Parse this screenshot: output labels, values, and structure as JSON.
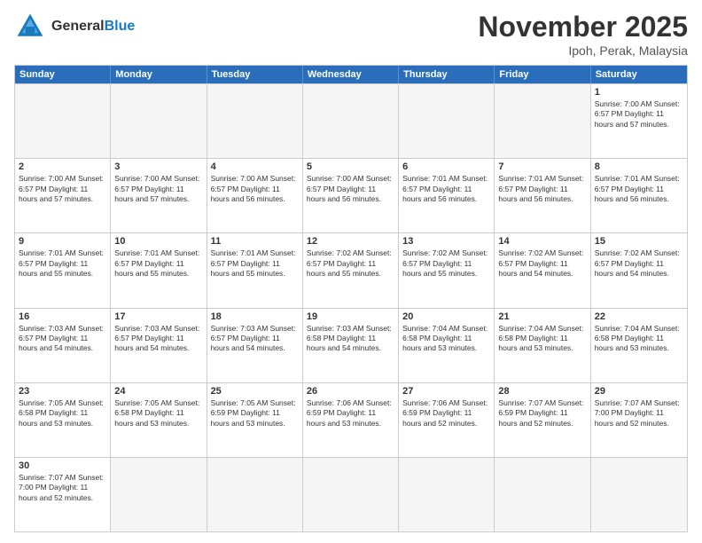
{
  "header": {
    "logo_general": "General",
    "logo_blue": "Blue",
    "month_title": "November 2025",
    "location": "Ipoh, Perak, Malaysia"
  },
  "weekdays": [
    "Sunday",
    "Monday",
    "Tuesday",
    "Wednesday",
    "Thursday",
    "Friday",
    "Saturday"
  ],
  "rows": [
    [
      {
        "day": "",
        "content": ""
      },
      {
        "day": "",
        "content": ""
      },
      {
        "day": "",
        "content": ""
      },
      {
        "day": "",
        "content": ""
      },
      {
        "day": "",
        "content": ""
      },
      {
        "day": "",
        "content": ""
      },
      {
        "day": "1",
        "content": "Sunrise: 7:00 AM\nSunset: 6:57 PM\nDaylight: 11 hours\nand 57 minutes."
      }
    ],
    [
      {
        "day": "2",
        "content": "Sunrise: 7:00 AM\nSunset: 6:57 PM\nDaylight: 11 hours\nand 57 minutes."
      },
      {
        "day": "3",
        "content": "Sunrise: 7:00 AM\nSunset: 6:57 PM\nDaylight: 11 hours\nand 57 minutes."
      },
      {
        "day": "4",
        "content": "Sunrise: 7:00 AM\nSunset: 6:57 PM\nDaylight: 11 hours\nand 56 minutes."
      },
      {
        "day": "5",
        "content": "Sunrise: 7:00 AM\nSunset: 6:57 PM\nDaylight: 11 hours\nand 56 minutes."
      },
      {
        "day": "6",
        "content": "Sunrise: 7:01 AM\nSunset: 6:57 PM\nDaylight: 11 hours\nand 56 minutes."
      },
      {
        "day": "7",
        "content": "Sunrise: 7:01 AM\nSunset: 6:57 PM\nDaylight: 11 hours\nand 56 minutes."
      },
      {
        "day": "8",
        "content": "Sunrise: 7:01 AM\nSunset: 6:57 PM\nDaylight: 11 hours\nand 56 minutes."
      }
    ],
    [
      {
        "day": "9",
        "content": "Sunrise: 7:01 AM\nSunset: 6:57 PM\nDaylight: 11 hours\nand 55 minutes."
      },
      {
        "day": "10",
        "content": "Sunrise: 7:01 AM\nSunset: 6:57 PM\nDaylight: 11 hours\nand 55 minutes."
      },
      {
        "day": "11",
        "content": "Sunrise: 7:01 AM\nSunset: 6:57 PM\nDaylight: 11 hours\nand 55 minutes."
      },
      {
        "day": "12",
        "content": "Sunrise: 7:02 AM\nSunset: 6:57 PM\nDaylight: 11 hours\nand 55 minutes."
      },
      {
        "day": "13",
        "content": "Sunrise: 7:02 AM\nSunset: 6:57 PM\nDaylight: 11 hours\nand 55 minutes."
      },
      {
        "day": "14",
        "content": "Sunrise: 7:02 AM\nSunset: 6:57 PM\nDaylight: 11 hours\nand 54 minutes."
      },
      {
        "day": "15",
        "content": "Sunrise: 7:02 AM\nSunset: 6:57 PM\nDaylight: 11 hours\nand 54 minutes."
      }
    ],
    [
      {
        "day": "16",
        "content": "Sunrise: 7:03 AM\nSunset: 6:57 PM\nDaylight: 11 hours\nand 54 minutes."
      },
      {
        "day": "17",
        "content": "Sunrise: 7:03 AM\nSunset: 6:57 PM\nDaylight: 11 hours\nand 54 minutes."
      },
      {
        "day": "18",
        "content": "Sunrise: 7:03 AM\nSunset: 6:57 PM\nDaylight: 11 hours\nand 54 minutes."
      },
      {
        "day": "19",
        "content": "Sunrise: 7:03 AM\nSunset: 6:58 PM\nDaylight: 11 hours\nand 54 minutes."
      },
      {
        "day": "20",
        "content": "Sunrise: 7:04 AM\nSunset: 6:58 PM\nDaylight: 11 hours\nand 53 minutes."
      },
      {
        "day": "21",
        "content": "Sunrise: 7:04 AM\nSunset: 6:58 PM\nDaylight: 11 hours\nand 53 minutes."
      },
      {
        "day": "22",
        "content": "Sunrise: 7:04 AM\nSunset: 6:58 PM\nDaylight: 11 hours\nand 53 minutes."
      }
    ],
    [
      {
        "day": "23",
        "content": "Sunrise: 7:05 AM\nSunset: 6:58 PM\nDaylight: 11 hours\nand 53 minutes."
      },
      {
        "day": "24",
        "content": "Sunrise: 7:05 AM\nSunset: 6:58 PM\nDaylight: 11 hours\nand 53 minutes."
      },
      {
        "day": "25",
        "content": "Sunrise: 7:05 AM\nSunset: 6:59 PM\nDaylight: 11 hours\nand 53 minutes."
      },
      {
        "day": "26",
        "content": "Sunrise: 7:06 AM\nSunset: 6:59 PM\nDaylight: 11 hours\nand 53 minutes."
      },
      {
        "day": "27",
        "content": "Sunrise: 7:06 AM\nSunset: 6:59 PM\nDaylight: 11 hours\nand 52 minutes."
      },
      {
        "day": "28",
        "content": "Sunrise: 7:07 AM\nSunset: 6:59 PM\nDaylight: 11 hours\nand 52 minutes."
      },
      {
        "day": "29",
        "content": "Sunrise: 7:07 AM\nSunset: 7:00 PM\nDaylight: 11 hours\nand 52 minutes."
      }
    ],
    [
      {
        "day": "30",
        "content": "Sunrise: 7:07 AM\nSunset: 7:00 PM\nDaylight: 11 hours\nand 52 minutes."
      },
      {
        "day": "",
        "content": ""
      },
      {
        "day": "",
        "content": ""
      },
      {
        "day": "",
        "content": ""
      },
      {
        "day": "",
        "content": ""
      },
      {
        "day": "",
        "content": ""
      },
      {
        "day": "",
        "content": ""
      }
    ]
  ]
}
